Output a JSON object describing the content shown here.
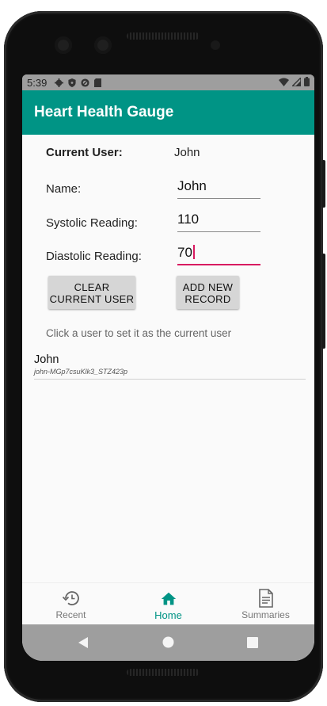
{
  "status": {
    "time": "5:39"
  },
  "app": {
    "title": "Heart Health Gauge"
  },
  "form": {
    "current_user_label": "Current User:",
    "current_user_value": "John",
    "name_label": "Name:",
    "name_value": "John",
    "systolic_label": "Systolic Reading:",
    "systolic_value": "110",
    "diastolic_label": "Diastolic Reading:",
    "diastolic_value": "70"
  },
  "buttons": {
    "clear_line1": "CLEAR",
    "clear_line2": "CURRENT USER",
    "add_line1": "ADD NEW",
    "add_line2": "RECORD"
  },
  "hint": "Click a user to set it as the current user",
  "users": [
    {
      "name": "John",
      "id": "john-MGp7csuKlk3_STZ423p"
    }
  ],
  "nav": {
    "items": [
      {
        "label": "Recent",
        "icon": "history-icon"
      },
      {
        "label": "Home",
        "icon": "home-icon",
        "active": true
      },
      {
        "label": "Summaries",
        "icon": "document-icon"
      }
    ]
  },
  "colors": {
    "primary": "#009485",
    "accent": "#d81b60"
  }
}
